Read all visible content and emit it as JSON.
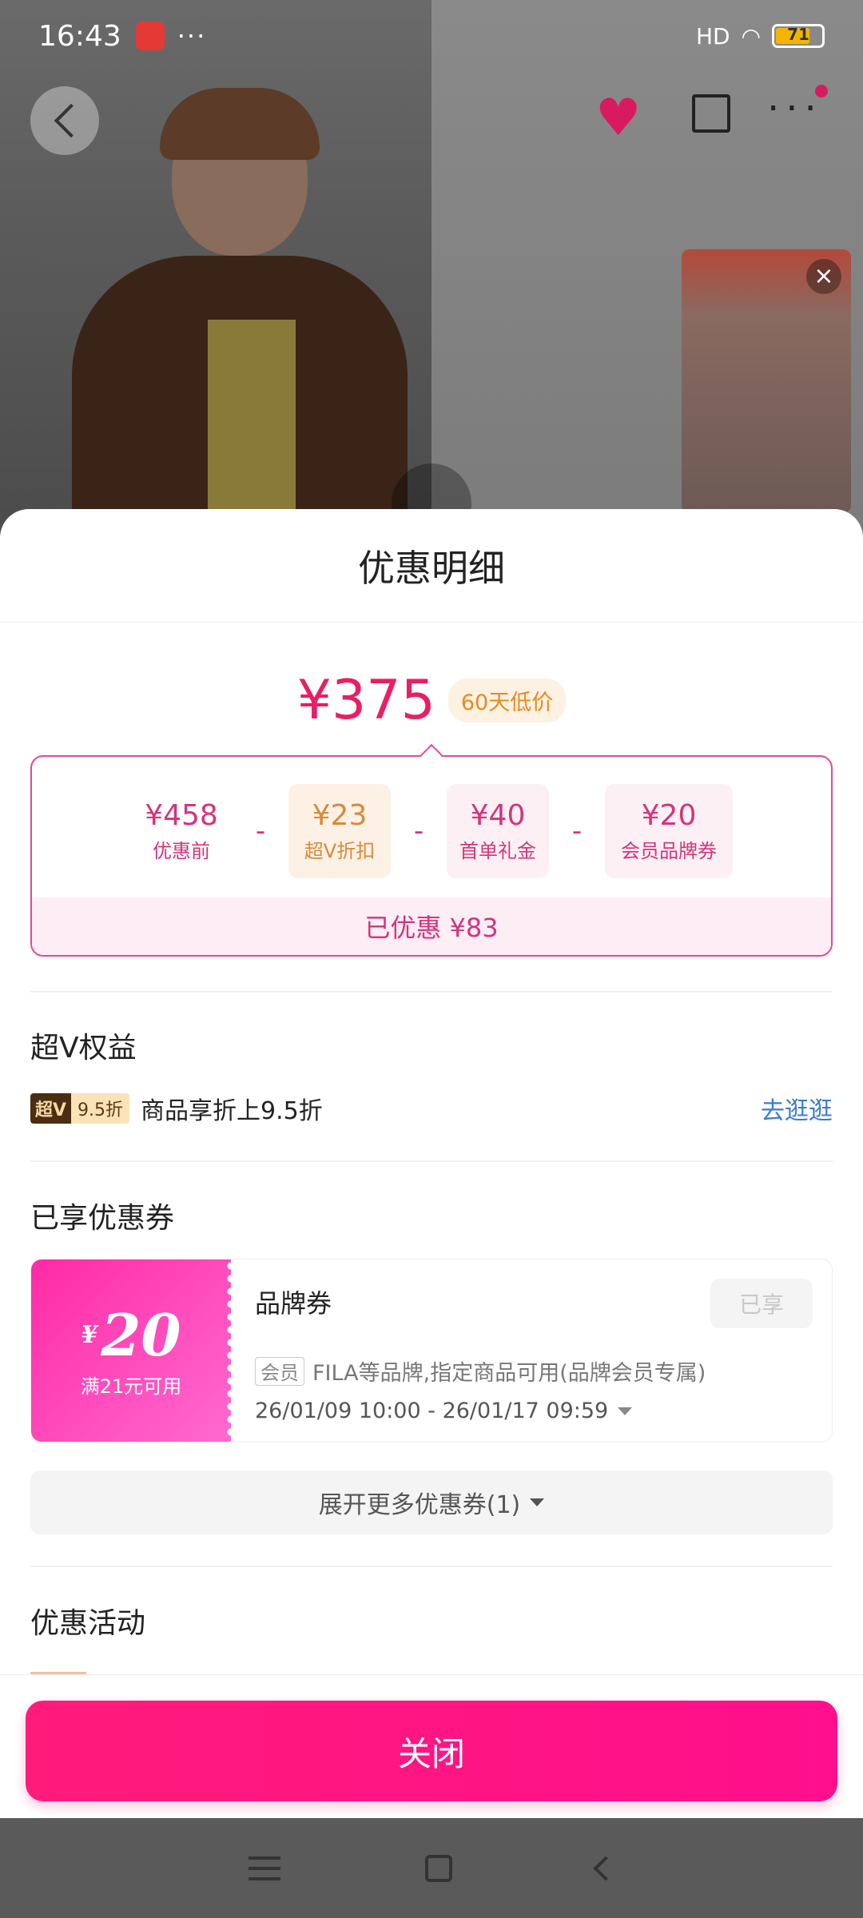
{
  "status_bar": {
    "time": "16:43",
    "dots": "···",
    "network": "HD",
    "battery": "71"
  },
  "background": {
    "icons": [
      "back-icon",
      "heart-icon",
      "share-icon",
      "more-icon",
      "close-icon",
      "play-icon"
    ]
  },
  "sheet": {
    "title": "优惠明细",
    "price": "¥375",
    "price_badge": "60天低价",
    "breakdown": [
      {
        "value": "¥458",
        "label": "优惠前"
      },
      {
        "value": "¥23",
        "label": "超V折扣"
      },
      {
        "value": "¥40",
        "label": "首单礼金"
      },
      {
        "value": "¥20",
        "label": "会员品牌券"
      }
    ],
    "minus": "-",
    "saved": "已优惠 ¥83",
    "chaov": {
      "title": "超V权益",
      "badge_left": "超V",
      "badge_right": "9.5折",
      "text": "商品享折上9.5折",
      "link": "去逛逛"
    },
    "coupons": {
      "title": "已享优惠券",
      "yen": "¥",
      "amount": "20",
      "condition": "满21元可用",
      "name": "品牌券",
      "status": "已享",
      "member_tag": "会员",
      "desc": "FILA等品牌,指定商品可用(品牌会员专属)",
      "date": "26/01/09 10:00 - 26/01/17 09:59",
      "expand": "展开更多优惠券(1)"
    },
    "activities_title": "优惠活动",
    "close": "关闭"
  }
}
